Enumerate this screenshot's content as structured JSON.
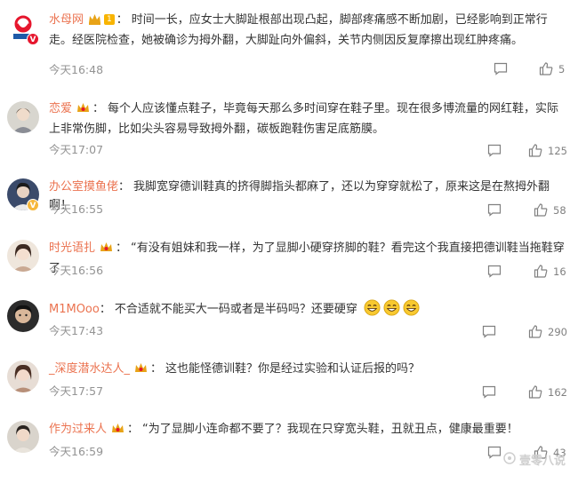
{
  "comments": [
    {
      "user": "水母网",
      "level": "1",
      "text": "时间一长，应女士大脚趾根部出现凸起，脚部疼痛感不断加剧，已经影响到正常行走。经医院检查，她被确诊为拇外翻，大脚趾向外偏斜，关节内侧因反复摩擦出现红肿疼痛。",
      "time": "今天16:48",
      "likes": "5",
      "badge_color": "#e6162d",
      "badge_symbol": "V"
    },
    {
      "user": "恋爱",
      "text": "每个人应该懂点鞋子，毕竟每天那么多时间穿在鞋子里。现在很多博流量的网红鞋，实际上非常伤脚，比如尖头容易导致拇外翻，碳板跑鞋伤害足底筋膜。",
      "time": "今天17:07",
      "likes": "125"
    },
    {
      "user": "办公室摸鱼佬",
      "text": "我脚宽穿德训鞋真的挤得脚指头都麻了，还以为穿穿就松了，原来这是在熬拇外翻啊！",
      "time": "今天16:55",
      "likes": "58",
      "badge_color": "#f6b73c",
      "badge_symbol": "V"
    },
    {
      "user": "时光语扎",
      "text": "“有没有姐妹和我一样，为了显脚小硬穿挤脚的鞋？看完这个我直接把德训鞋当拖鞋穿了",
      "time": "今天16:56",
      "likes": "16"
    },
    {
      "user": "M1MOoo",
      "text": "不合适就不能买大一码或者是半码吗？还要硬穿",
      "time": "今天17:43",
      "likes": "290"
    },
    {
      "user": "_深度潜水达人_",
      "text": "这也能怪德训鞋？你是经过实验和认证后报的吗？",
      "time": "今天17:57",
      "likes": "162"
    },
    {
      "user": "作为过来人",
      "text": "“为了显脚小连命都不要了？我现在只穿宽头鞋，丑就丑点，健康最重要！",
      "time": "今天16:59",
      "likes": "43"
    }
  ],
  "watermark": "壹零八说",
  "colors": {
    "username": "#eb7350",
    "time": "#939393",
    "icon": "#808080"
  },
  "icons": [
    "comment-icon",
    "thumbs-up-icon",
    "crown-icon",
    "laughing-emoji-icon"
  ]
}
